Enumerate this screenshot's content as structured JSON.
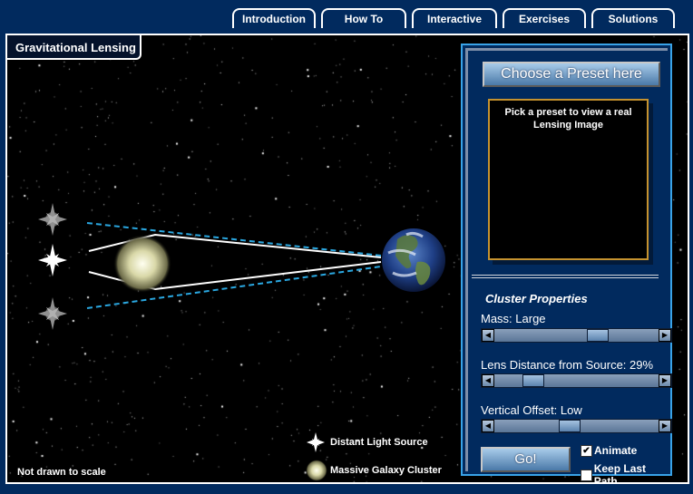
{
  "tabs": [
    {
      "label": "Introduction",
      "active": false
    },
    {
      "label": "How To",
      "active": false
    },
    {
      "label": "Interactive",
      "active": true
    },
    {
      "label": "Exercises",
      "active": false
    },
    {
      "label": "Solutions",
      "active": false
    }
  ],
  "scene": {
    "title": "Gravitational Lensing",
    "note": "Not drawn to scale",
    "legend": {
      "light_source": "Distant Light Source",
      "galaxy_cluster": "Massive Galaxy Cluster"
    }
  },
  "panel": {
    "preset_button": "Choose a Preset here",
    "preview_text": "Pick a preset to view a real Lensing Image",
    "section_title": "Cluster Properties",
    "sliders": [
      {
        "label": "Mass: Large",
        "value_fraction": 0.65
      },
      {
        "label": "Lens Distance from Source: 29%",
        "value_fraction": 0.2
      },
      {
        "label": "Vertical Offset: Low",
        "value_fraction": 0.45
      }
    ],
    "go_button": "Go!",
    "checkboxes": [
      {
        "label": "Animate",
        "checked": true
      },
      {
        "label": "Keep Last Path",
        "checked": false
      }
    ]
  },
  "colors": {
    "background": "#012a5e",
    "panel_border": "#39a3e8",
    "preview_border": "#c5922f",
    "ray_dashed": "#2aa7e0"
  }
}
